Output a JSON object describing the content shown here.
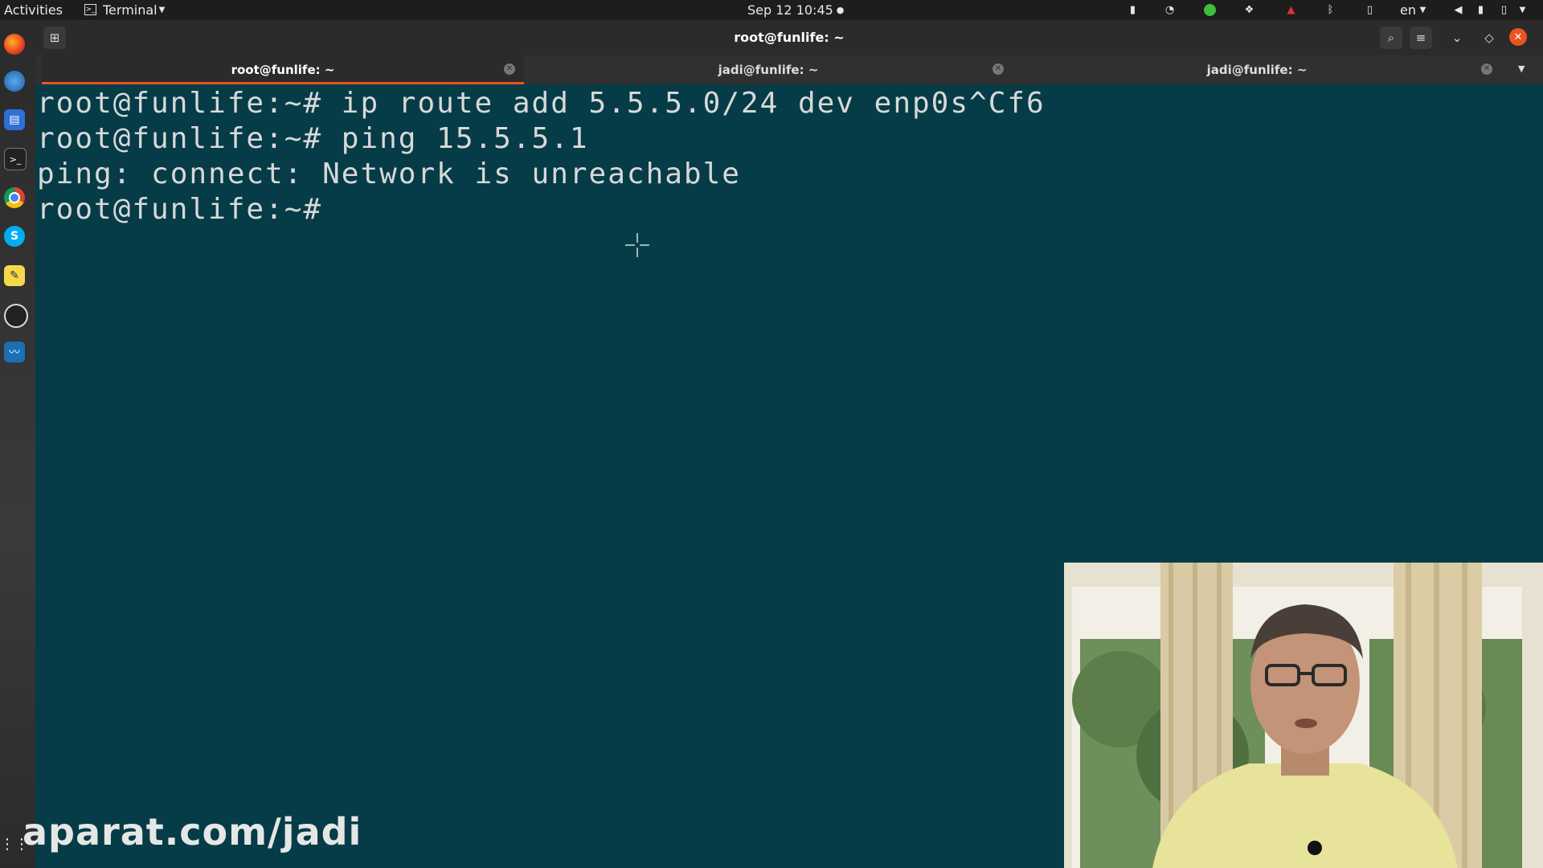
{
  "topbar": {
    "activities": "Activities",
    "app_menu": "Terminal",
    "clock": "Sep 12  10:45",
    "lang": "en"
  },
  "window": {
    "title": "root@funlife: ~"
  },
  "tabs": [
    {
      "label": "root@funlife: ~",
      "active": true
    },
    {
      "label": "jadi@funlife: ~",
      "active": false
    },
    {
      "label": "jadi@funlife: ~",
      "active": false
    }
  ],
  "terminal": {
    "lines": [
      "root@funlife:~# ip route add 5.5.5.0/24 dev enp0s^Cf6",
      "root@funlife:~# ping 15.5.5.1",
      "ping: connect: Network is unreachable",
      "root@funlife:~#"
    ]
  },
  "watermark": "aparat.com/jadi",
  "colors": {
    "terminal_bg": "#053c47",
    "terminal_fg": "#d8d8d8",
    "active_tab_underline": "#e95420",
    "close_button": "#e95420"
  }
}
